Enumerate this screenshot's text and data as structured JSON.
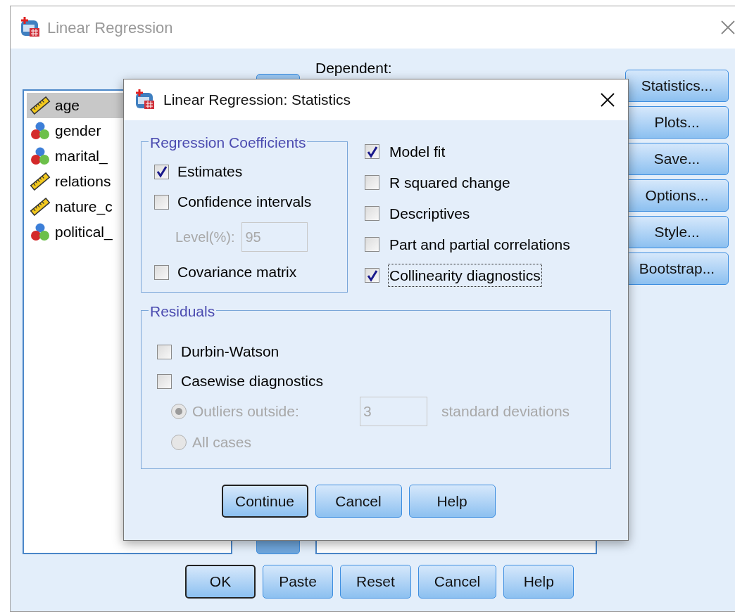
{
  "window": {
    "title": "Linear Regression"
  },
  "variables": [
    {
      "name": "age",
      "kind": "scale",
      "selected": true
    },
    {
      "name": "gender",
      "kind": "nominal",
      "selected": false
    },
    {
      "name": "marital_",
      "kind": "nominal",
      "selected": false
    },
    {
      "name": "relations",
      "kind": "scale",
      "selected": false
    },
    {
      "name": "nature_c",
      "kind": "scale",
      "selected": false
    },
    {
      "name": "political_",
      "kind": "nominal",
      "selected": false
    }
  ],
  "dependent": {
    "label": "Dependent:"
  },
  "side_buttons": [
    "Statistics...",
    "Plots...",
    "Save...",
    "Options...",
    "Style...",
    "Bootstrap..."
  ],
  "buttons": [
    {
      "label": "OK",
      "default": true
    },
    {
      "label": "Paste",
      "default": false
    },
    {
      "label": "Reset",
      "default": false
    },
    {
      "label": "Cancel",
      "default": false
    },
    {
      "label": "Help",
      "default": false
    }
  ],
  "dialog": {
    "title": "Linear Regression: Statistics",
    "coefficients": {
      "title": "Regression Coefficients",
      "items": [
        {
          "kind": "checkbox",
          "label": "Estimates",
          "checked": true
        },
        {
          "kind": "checkbox",
          "label": "Confidence intervals",
          "checked": false
        },
        {
          "kind": "field",
          "label": "Level(%):",
          "value": "95",
          "disabled": true
        },
        {
          "kind": "checkbox",
          "label": "Covariance matrix",
          "checked": false
        }
      ]
    },
    "options": [
      {
        "label": "Model fit",
        "checked": true,
        "focused": false
      },
      {
        "label": "R squared change",
        "checked": false,
        "focused": false
      },
      {
        "label": "Descriptives",
        "checked": false,
        "focused": false
      },
      {
        "label": "Part and partial correlations",
        "checked": false,
        "focused": false
      },
      {
        "label": "Collinearity diagnostics",
        "checked": true,
        "focused": true
      }
    ],
    "residuals": {
      "title": "Residuals",
      "items": [
        {
          "kind": "checkbox",
          "label": "Durbin-Watson",
          "checked": false
        },
        {
          "kind": "checkbox",
          "label": "Casewise diagnostics",
          "checked": false
        },
        {
          "kind": "radio",
          "label": "Outliers outside:",
          "selected": true,
          "disabled": true,
          "value": "3",
          "suffix": "standard deviations"
        },
        {
          "kind": "radio",
          "label": "All cases",
          "selected": false,
          "disabled": true
        }
      ]
    },
    "buttons": [
      {
        "label": "Continue",
        "default": true
      },
      {
        "label": "Cancel",
        "default": false
      },
      {
        "label": "Help",
        "default": false
      }
    ]
  }
}
